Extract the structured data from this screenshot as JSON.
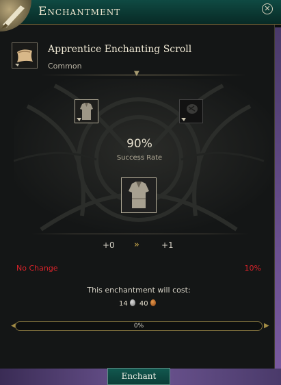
{
  "window": {
    "title": "Enchantment"
  },
  "item": {
    "name": "Apprentice Enchanting Scroll",
    "rarity": "Common"
  },
  "success": {
    "rate": "90%",
    "label": "Success Rate"
  },
  "level": {
    "from": "+0",
    "arrow": "»",
    "to": "+1"
  },
  "failure": {
    "label": "No Change",
    "chance": "10%"
  },
  "cost": {
    "label": "This enchantment will cost:",
    "silver": "14",
    "copper": "40"
  },
  "progress": {
    "value": 0,
    "text": "0%"
  },
  "actions": {
    "enchant_label": "Enchant"
  },
  "colors": {
    "accent_teal": "#0f4a43",
    "warning_red": "#d8232a",
    "gold": "#c8a64a"
  },
  "icons": {
    "close": "close-icon",
    "scroll": "scroll-icon",
    "armor": "armor-icon",
    "reagent": "reagent-icon",
    "silver": "silver-coin-icon",
    "copper": "copper-coin-icon"
  }
}
